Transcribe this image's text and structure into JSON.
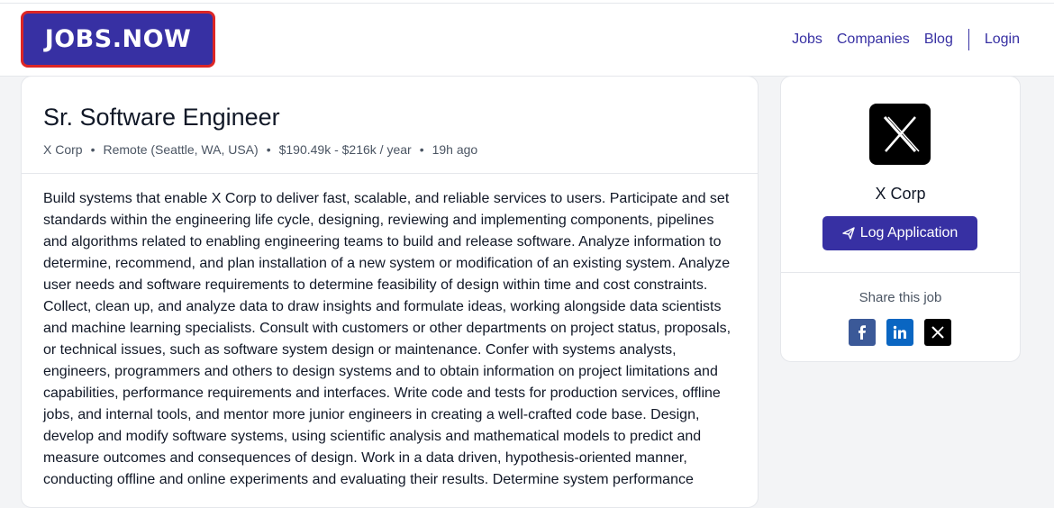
{
  "brand": {
    "logo_text": "JOBS.NOW"
  },
  "nav": {
    "jobs": "Jobs",
    "companies": "Companies",
    "blog": "Blog",
    "login": "Login"
  },
  "job": {
    "title": "Sr. Software Engineer",
    "company": "X Corp",
    "location": "Remote (Seattle, WA, USA)",
    "salary": "$190.49k - $216k / year",
    "posted": "19h ago",
    "description": "Build systems that enable X Corp to deliver fast, scalable, and reliable services to users. Participate and set standards within the engineering life cycle, designing, reviewing and implementing components, pipelines and algorithms related to enabling engineering teams to build and release software. Analyze information to determine, recommend, and plan installation of a new system or modification of an existing system. Analyze user needs and software requirements to determine feasibility of design within time and cost constraints. Collect, clean up, and analyze data to draw insights and formulate ideas, working alongside data scientists and machine learning specialists. Consult with customers or other departments on project status, proposals, or technical issues, such as software system design or maintenance. Confer with systems analysts, engineers, programmers and others to design systems and to obtain information on project limitations and capabilities, performance requirements and interfaces. Write code and tests for production services, offline jobs, and internal tools, and mentor more junior engineers in creating a well-crafted code base. Design, develop and modify software systems, using scientific analysis and mathematical models to predict and measure outcomes and consequences of design. Work in a data driven, hypothesis-oriented manner, conducting offline and online experiments and evaluating their results. Determine system performance"
  },
  "sidebar": {
    "company_name": "X Corp",
    "apply_label": "Log Application",
    "share_label": "Share this job",
    "share_icons": [
      "facebook-icon",
      "linkedin-icon",
      "x-icon"
    ]
  },
  "colors": {
    "brand": "#3730a3",
    "logo_border": "#dc2626",
    "facebook": "#3b5998",
    "linkedin": "#0a66c2"
  }
}
